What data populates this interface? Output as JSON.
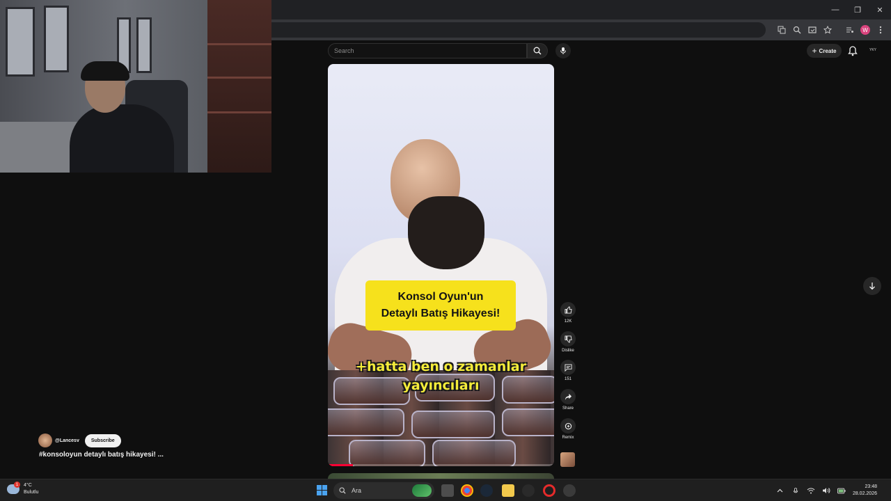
{
  "browser": {
    "minimize_glyph": "—",
    "restore_glyph": "❐",
    "close_glyph": "✕",
    "profile_letter": "W"
  },
  "youtube": {
    "search_placeholder": "Search",
    "create_label": "Create",
    "top_avatar_text": "YKY"
  },
  "video": {
    "caption_line1": "Konsol Oyun'un",
    "caption_line2": "Detaylı Batış Hikayesi!",
    "subtitle_line1": "+hatta ben o zamanlar",
    "subtitle_line2": "yayıncıları",
    "progress_fraction": 0.11
  },
  "actions": {
    "like_count": "12K",
    "dislike_label": "Dislike",
    "comment_count": "151",
    "share_label": "Share",
    "remix_label": "Remix"
  },
  "channel": {
    "handle": "@Lancesv",
    "subscribe_label": "Subscribe",
    "video_title": "#konsoloyun detaylı batış hikayesi! ..."
  },
  "taskbar": {
    "temperature": "4°C",
    "weather_condition": "Bulutlu",
    "weather_badge": "1",
    "search_label": "Ara",
    "time": "23:48",
    "date": "28.02.2026"
  },
  "colors": {
    "subscribe_bg": "#f1f1f1",
    "caption_bg": "#f6e11c",
    "subtitle_color": "#f4ec3a",
    "progress_red": "#ff0033"
  }
}
